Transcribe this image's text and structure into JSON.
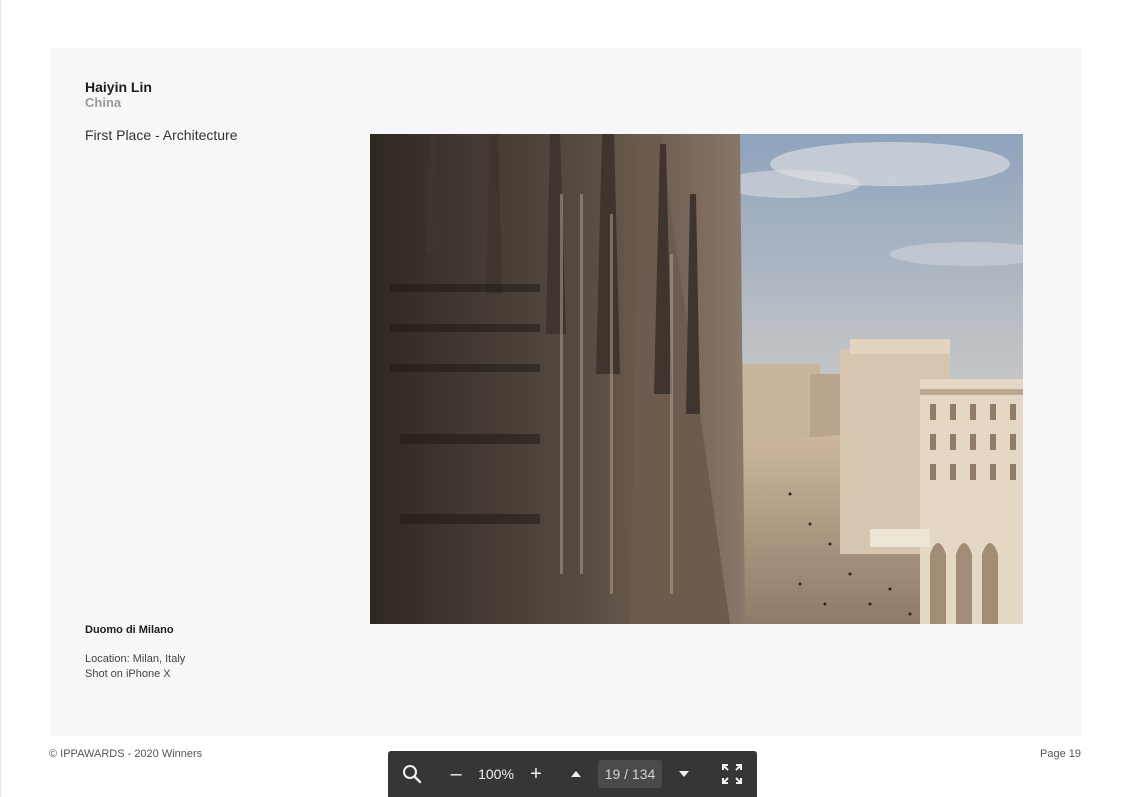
{
  "entry": {
    "author": "Haiyin Lin",
    "country": "China",
    "award": "First Place - Architecture",
    "photo_title": "Duomo di Milano",
    "location": "Location: Milan, Italy",
    "device": "Shot on iPhone X"
  },
  "footer": {
    "copyright": "© IPPAWARDS - 2020 Winners",
    "page_label": "Page 19"
  },
  "toolbar": {
    "zoom_out": "–",
    "zoom_level": "100%",
    "zoom_in": "+",
    "page_indicator": "19 / 134",
    "icons": [
      "search-icon",
      "triangle-up-icon",
      "triangle-down-icon",
      "fullscreen-icon"
    ]
  }
}
